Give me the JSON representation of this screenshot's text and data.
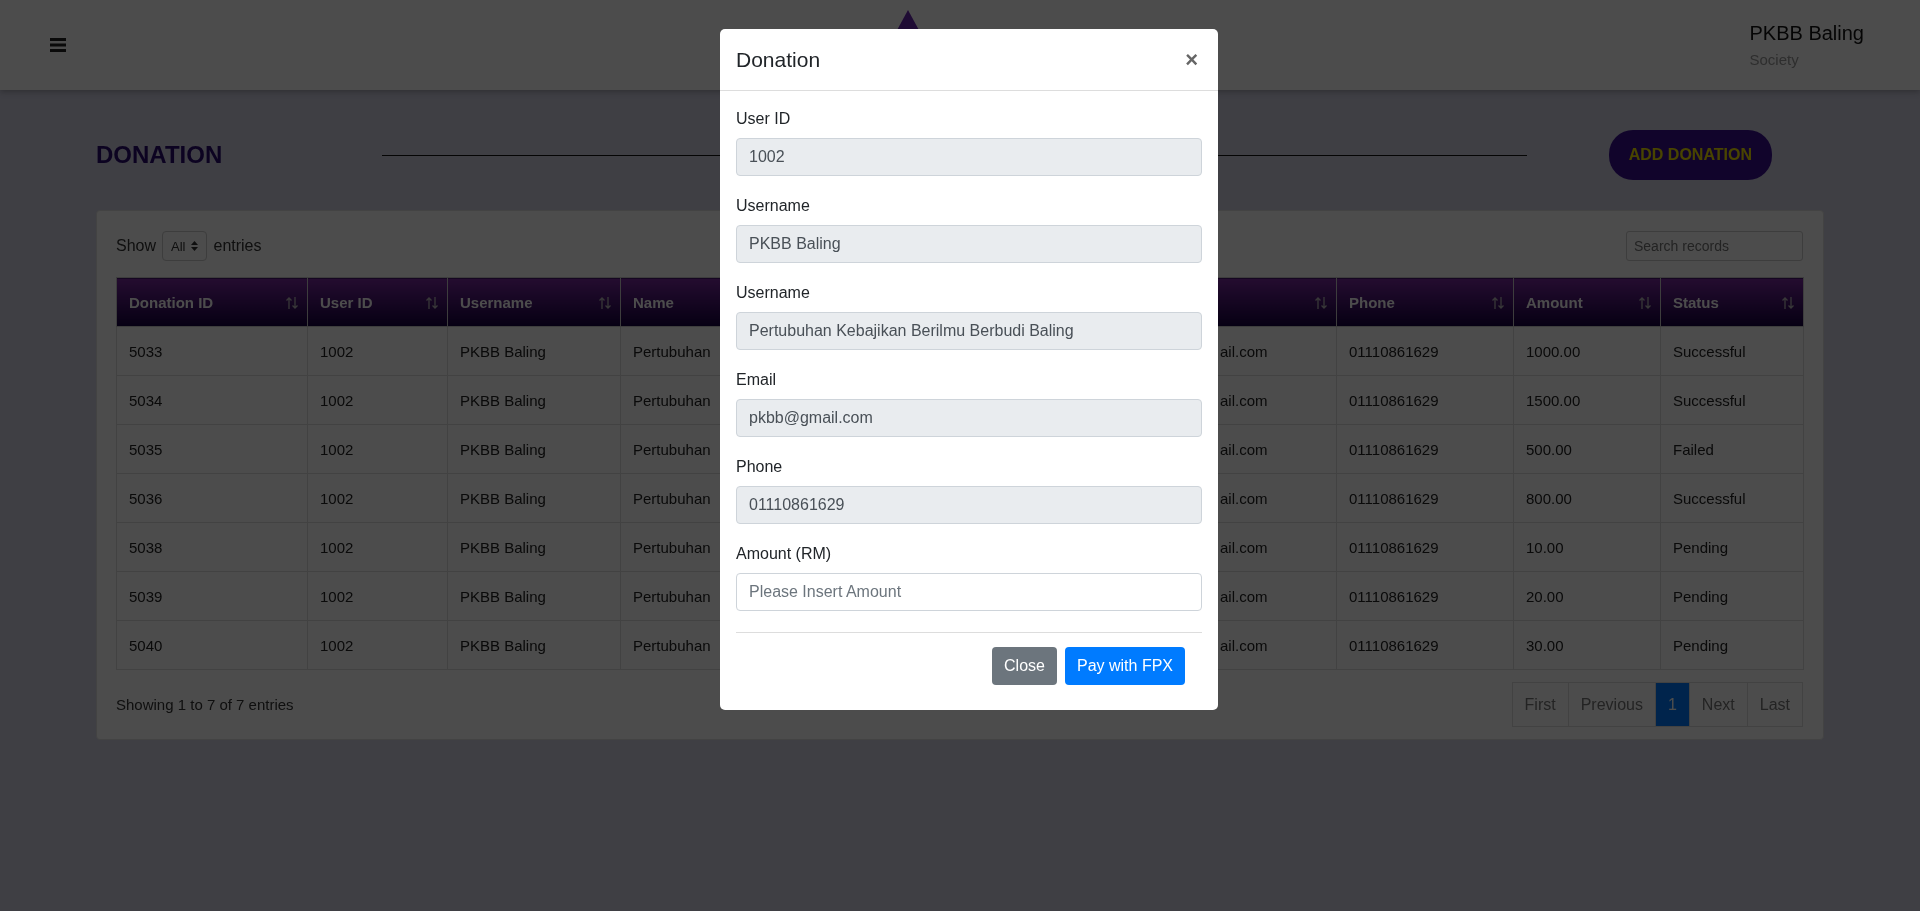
{
  "header": {
    "user_name": "PKBB Baling",
    "user_role": "Society"
  },
  "page": {
    "title": "DONATION",
    "add_button": "ADD DONATION"
  },
  "table_controls": {
    "show_label": "Show",
    "page_size": "All",
    "entries_label": "entries",
    "search_placeholder": "Search records"
  },
  "table": {
    "columns": [
      {
        "label": "Donation ID",
        "sort_icon": true
      },
      {
        "label": "User ID",
        "sort_icon": true
      },
      {
        "label": "Username",
        "sort_icon": true
      },
      {
        "label": "Name",
        "sort_icon": false
      },
      {
        "sort_icon": true
      },
      {
        "label": "Phone",
        "sort_icon": true
      },
      {
        "label": "Amount",
        "sort_icon": true
      },
      {
        "label": "Status",
        "sort_icon": true
      }
    ],
    "rows": [
      [
        "5033",
        "1002",
        "PKBB Baling",
        "Pertubuhan",
        "ail.com",
        "01110861629",
        "1000.00",
        "Successful"
      ],
      [
        "5034",
        "1002",
        "PKBB Baling",
        "Pertubuhan",
        "ail.com",
        "01110861629",
        "1500.00",
        "Successful"
      ],
      [
        "5035",
        "1002",
        "PKBB Baling",
        "Pertubuhan",
        "ail.com",
        "01110861629",
        "500.00",
        "Failed"
      ],
      [
        "5036",
        "1002",
        "PKBB Baling",
        "Pertubuhan",
        "ail.com",
        "01110861629",
        "800.00",
        "Successful"
      ],
      [
        "5038",
        "1002",
        "PKBB Baling",
        "Pertubuhan",
        "ail.com",
        "01110861629",
        "10.00",
        "Pending"
      ],
      [
        "5039",
        "1002",
        "PKBB Baling",
        "Pertubuhan",
        "ail.com",
        "01110861629",
        "20.00",
        "Pending"
      ],
      [
        "5040",
        "1002",
        "PKBB Baling",
        "Pertubuhan",
        "ail.com",
        "01110861629",
        "30.00",
        "Pending"
      ]
    ]
  },
  "table_info": "Showing 1 to 7 of 7 entries",
  "pagination": [
    {
      "label": "First",
      "selected": false
    },
    {
      "label": "Previous",
      "selected": false
    },
    {
      "label": "1",
      "selected": true
    },
    {
      "label": "Next",
      "selected": false
    },
    {
      "label": "Last",
      "selected": false
    }
  ],
  "modal": {
    "title": "Donation",
    "close": "×",
    "fields": [
      {
        "label": "User ID",
        "value": "1002",
        "disabled": true
      },
      {
        "label": "Username",
        "value": "PKBB Baling",
        "disabled": true
      },
      {
        "label": "Username",
        "value": "Pertubuhan Kebajikan Berilmu Berbudi Baling",
        "disabled": true
      },
      {
        "label": "Email",
        "value": "pkbb@gmail.com",
        "disabled": true
      },
      {
        "label": "Phone",
        "value": "01110861629",
        "disabled": true
      },
      {
        "label": "Amount (RM)",
        "placeholder": "Please Insert Amount",
        "disabled": false
      }
    ],
    "buttons": [
      {
        "label": "Close",
        "kind": "secondary"
      },
      {
        "label": "Pay with FPX",
        "kind": "primary"
      }
    ]
  }
}
